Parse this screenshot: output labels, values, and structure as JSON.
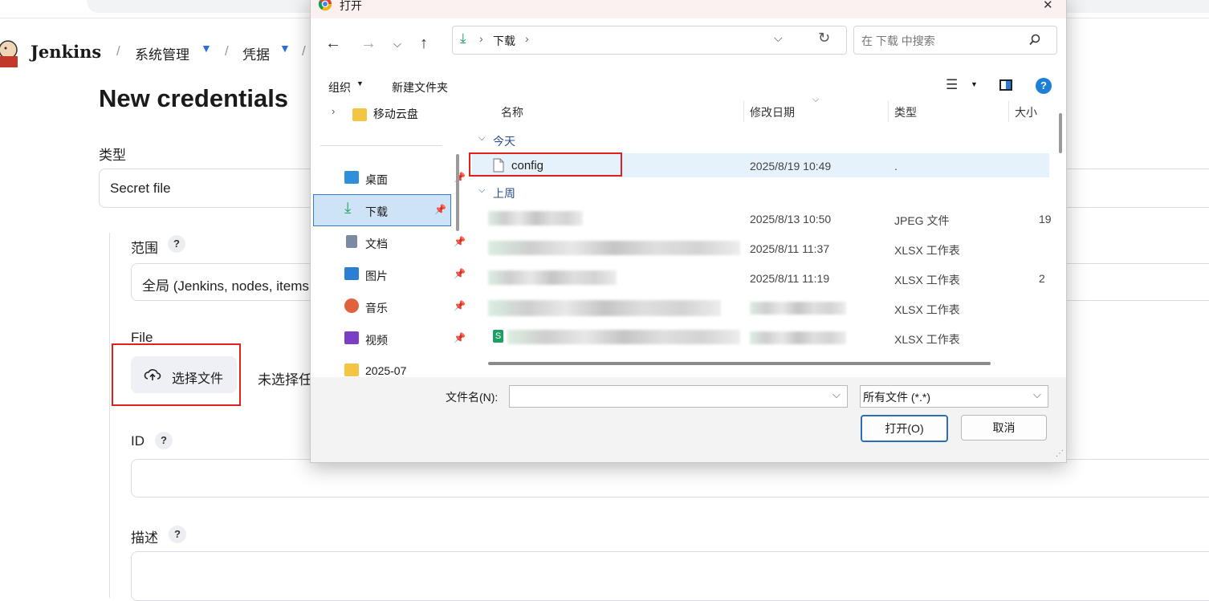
{
  "jenkins": {
    "brand": "Jenkins",
    "breadcrumbs": [
      "系统管理",
      "凭据"
    ],
    "breadcrumb_sep": "/",
    "page_title": "New credentials",
    "type_label": "类型",
    "type_value": "Secret file",
    "scope_label": "范围",
    "scope_value": "全局 (Jenkins, nodes, items",
    "file_label": "File",
    "choose_file_button": "选择文件",
    "no_file_text": "未选择任",
    "id_label": "ID",
    "desc_label": "描述",
    "help_glyph": "?"
  },
  "dialog": {
    "title": "打开",
    "close_glyph": "✕",
    "path_segment": "下载",
    "search_placeholder": "在 下载 中搜索",
    "organize_label": "组织",
    "new_folder_label": "新建文件夹",
    "help_glyph": "?",
    "nav_items": [
      {
        "label": "移动云盘",
        "icon": "folder-icon",
        "color": "#f4c542"
      },
      {
        "label": "桌面",
        "icon": "desktop-icon",
        "color": "#2f8fd8"
      },
      {
        "label": "下载",
        "icon": "download-icon",
        "color": "#1d9e63"
      },
      {
        "label": "文档",
        "icon": "document-icon",
        "color": "#7a8aa3"
      },
      {
        "label": "图片",
        "icon": "pictures-icon",
        "color": "#2a7fd4"
      },
      {
        "label": "音乐",
        "icon": "music-icon",
        "color": "#e0613e"
      },
      {
        "label": "视频",
        "icon": "video-icon",
        "color": "#7a3fc4"
      },
      {
        "label": "2025-07",
        "icon": "folder-icon",
        "color": "#f4c542"
      }
    ],
    "columns": [
      "名称",
      "修改日期",
      "类型",
      "大小"
    ],
    "groups": {
      "today": "今天",
      "last_week": "上周"
    },
    "files": [
      {
        "name": "config",
        "date": "2025/8/19 10:49",
        "type": ".",
        "size": ""
      },
      {
        "name": "",
        "date": "2025/8/13 10:50",
        "type": "JPEG 文件",
        "size": "19"
      },
      {
        "name": "",
        "date": "2025/8/11 11:37",
        "type": "XLSX 工作表",
        "size": ""
      },
      {
        "name": "",
        "date": "2025/8/11 11:19",
        "type": "XLSX 工作表",
        "size": "2"
      },
      {
        "name": "",
        "date": "",
        "type": "XLSX 工作表",
        "size": ""
      },
      {
        "name": "",
        "date": "",
        "type": "XLSX 工作表",
        "size": ""
      }
    ],
    "filename_label": "文件名(N):",
    "filename_value": "",
    "filetype_value": "所有文件 (*.*)",
    "open_button": "打开(O)",
    "cancel_button": "取消"
  }
}
